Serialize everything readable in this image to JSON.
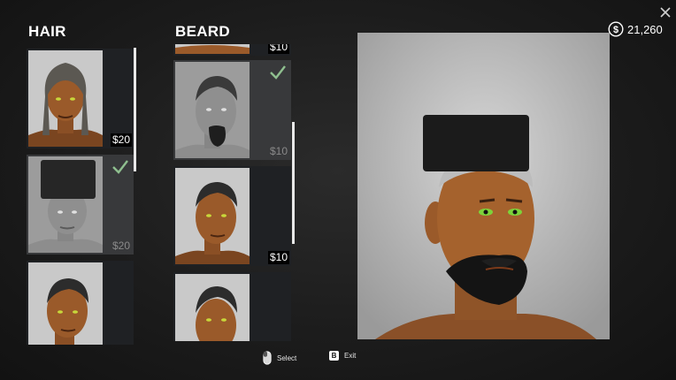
{
  "close_icon": "close-icon",
  "currency": {
    "icon": "dollar-coin-icon",
    "amount": "21,260"
  },
  "hair": {
    "title": "HAIR",
    "items": [
      {
        "price": "$20",
        "owned": false,
        "selected": false,
        "style": "dreadlocks"
      },
      {
        "price": "$20",
        "owned": true,
        "selected": true,
        "style": "tall-flat-top"
      },
      {
        "price": "",
        "owned": false,
        "selected": false,
        "style": "buzz-cut"
      }
    ]
  },
  "beard": {
    "title": "BEARD",
    "items": [
      {
        "price": "$10",
        "owned": false,
        "selected": false,
        "style": "partial"
      },
      {
        "price": "$10",
        "owned": true,
        "selected": true,
        "style": "goatee"
      },
      {
        "price": "$10",
        "owned": false,
        "selected": false,
        "style": "clean-shaven"
      },
      {
        "price": "",
        "owned": false,
        "selected": false,
        "style": "clean-shaven"
      }
    ]
  },
  "hints": {
    "select_label": "Select",
    "exit_key": "B",
    "exit_label": "Exit"
  },
  "colors": {
    "accent_check": "#8fbf8f",
    "panel_dark": "#1f2124",
    "panel_selected": "#38393b"
  }
}
